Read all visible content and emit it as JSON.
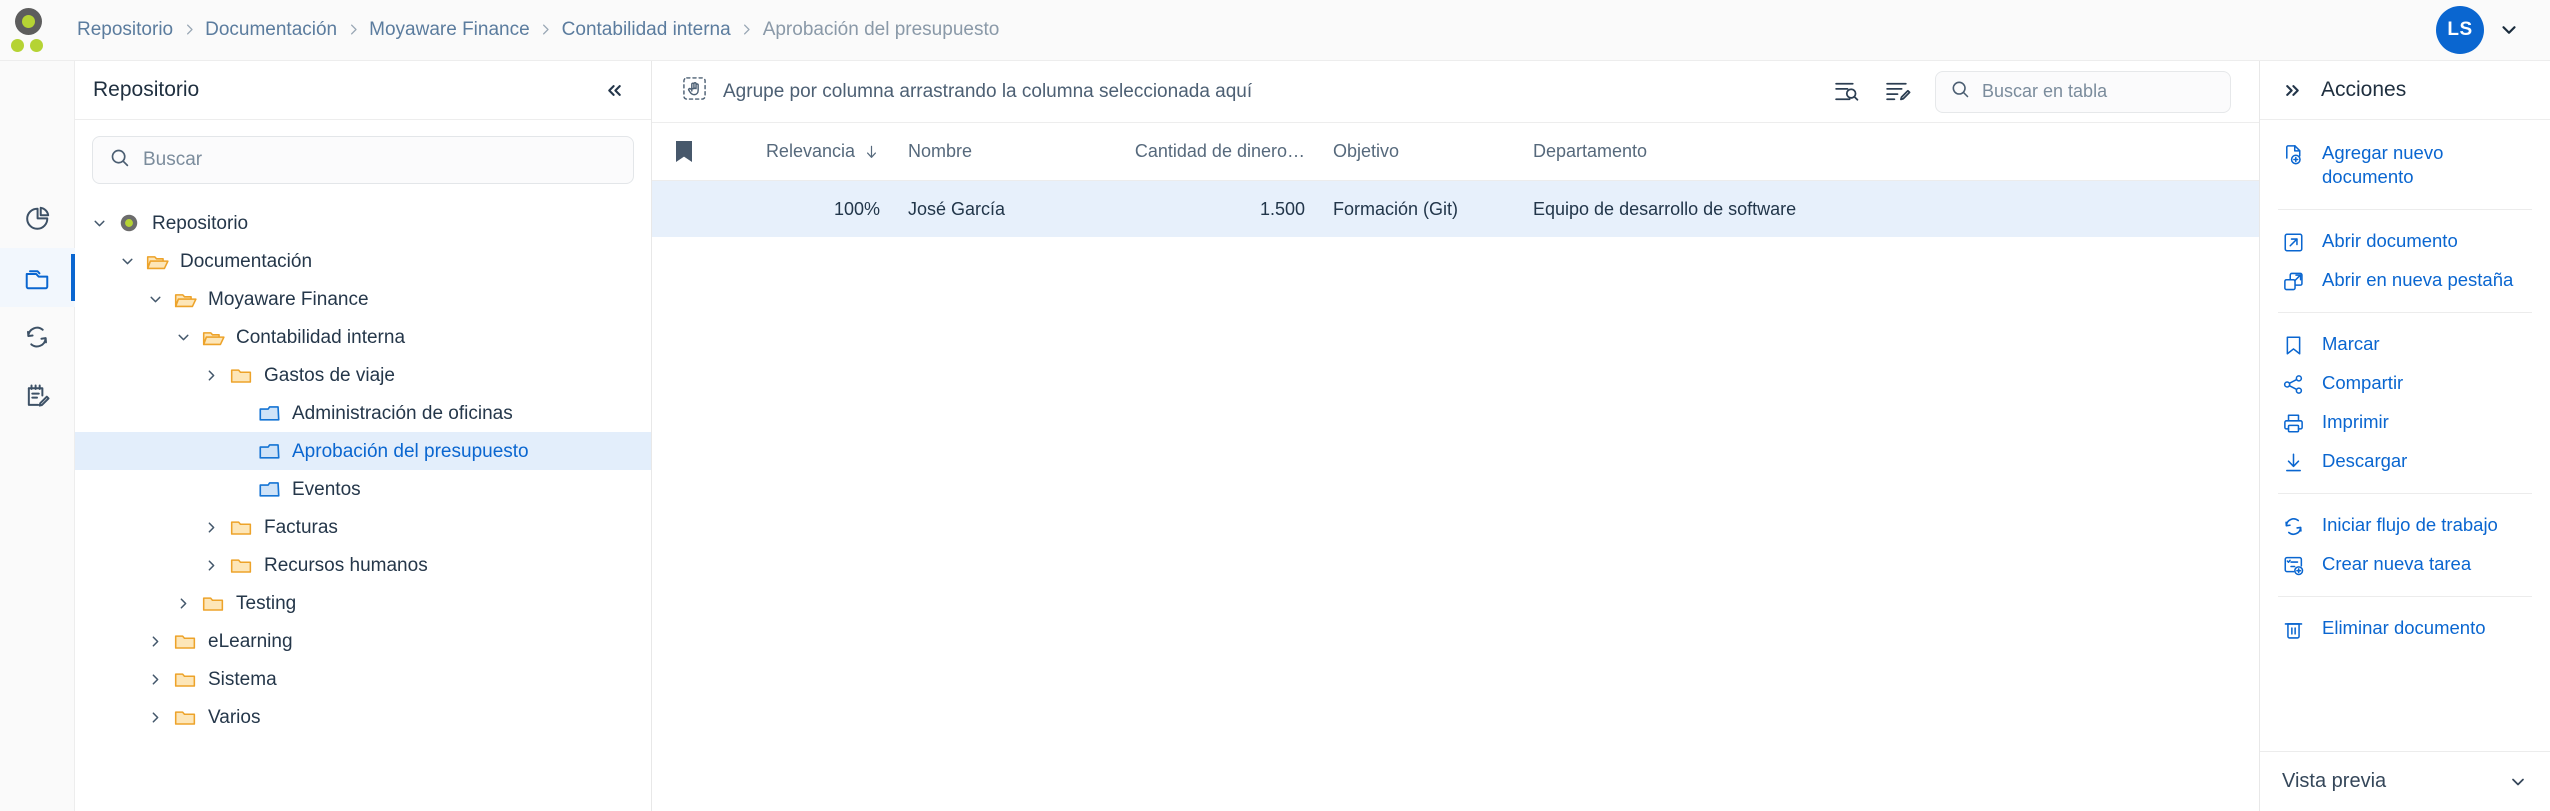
{
  "topbar": {
    "logo_name": "app-logo",
    "breadcrumb": [
      {
        "label": "Repositorio",
        "current": false
      },
      {
        "label": "Documentación",
        "current": false
      },
      {
        "label": "Moyaware Finance",
        "current": false
      },
      {
        "label": "Contabilidad interna",
        "current": false
      },
      {
        "label": "Aprobación del presupuesto",
        "current": true
      }
    ],
    "avatar_initials": "LS"
  },
  "rail": {
    "items": [
      {
        "icon": "pie-chart-icon",
        "active": false
      },
      {
        "icon": "folder-icon",
        "active": true
      },
      {
        "icon": "refresh-sync-icon",
        "active": false
      },
      {
        "icon": "notepad-edit-icon",
        "active": false
      }
    ]
  },
  "tree_panel": {
    "title": "Repositorio",
    "collapse_icon": "chevrons-left-icon",
    "search": {
      "value": "",
      "placeholder": "Buscar",
      "icon": "search-icon"
    },
    "nodes": [
      {
        "label": "Repositorio",
        "depth": 0,
        "twisty": "down",
        "icon": "repo-dot",
        "selected": false
      },
      {
        "label": "Documentación",
        "depth": 1,
        "twisty": "down",
        "icon": "folder-open",
        "selected": false
      },
      {
        "label": "Moyaware Finance",
        "depth": 2,
        "twisty": "down",
        "icon": "folder-open",
        "selected": false
      },
      {
        "label": "Contabilidad interna",
        "depth": 3,
        "twisty": "down",
        "icon": "folder-open",
        "selected": false
      },
      {
        "label": "Gastos de viaje",
        "depth": 4,
        "twisty": "right",
        "icon": "folder",
        "selected": false
      },
      {
        "label": "Administración de oficinas",
        "depth": 5,
        "twisty": "none",
        "icon": "folder-blue",
        "selected": false
      },
      {
        "label": "Aprobación del presupuesto",
        "depth": 5,
        "twisty": "none",
        "icon": "folder-blue",
        "selected": true
      },
      {
        "label": "Eventos",
        "depth": 5,
        "twisty": "none",
        "icon": "folder-blue",
        "selected": false
      },
      {
        "label": "Facturas",
        "depth": 4,
        "twisty": "right",
        "icon": "folder",
        "selected": false
      },
      {
        "label": "Recursos humanos",
        "depth": 4,
        "twisty": "right",
        "icon": "folder",
        "selected": false
      },
      {
        "label": "Testing",
        "depth": 3,
        "twisty": "right",
        "icon": "folder",
        "selected": false
      },
      {
        "label": "eLearning",
        "depth": 2,
        "twisty": "right",
        "icon": "folder",
        "selected": false
      },
      {
        "label": "Sistema",
        "depth": 2,
        "twisty": "right",
        "icon": "folder",
        "selected": false
      },
      {
        "label": "Varios",
        "depth": 2,
        "twisty": "right",
        "icon": "folder",
        "selected": false
      }
    ]
  },
  "grid": {
    "group_hint": "Agrupe por columna arrastrando la columna seleccionada aquí",
    "group_hint_icon": "drag-hand-icon",
    "toolbar_icons": [
      {
        "name": "column-filter-icon"
      },
      {
        "name": "edit-list-icon"
      }
    ],
    "search": {
      "value": "",
      "placeholder": "Buscar en tabla",
      "icon": "search-icon"
    },
    "columns": [
      {
        "key": "flag",
        "label": "",
        "icon": "bookmark-icon",
        "sort": null
      },
      {
        "key": "rel",
        "label": "Relevancia",
        "icon": null,
        "sort": "desc"
      },
      {
        "key": "name",
        "label": "Nombre",
        "icon": null,
        "sort": null
      },
      {
        "key": "amt",
        "label": "Cantidad de dinero…",
        "icon": null,
        "sort": null
      },
      {
        "key": "obj",
        "label": "Objetivo",
        "icon": null,
        "sort": null
      },
      {
        "key": "dep",
        "label": "Departamento",
        "icon": null,
        "sort": null
      }
    ],
    "rows": [
      {
        "flag": "",
        "rel": "100%",
        "name": "José García",
        "amt": "1.500",
        "obj": "Formación (Git)",
        "dep": "Equipo de desarrollo de software",
        "selected": true
      }
    ]
  },
  "actions": {
    "title": "Acciones",
    "expand_icon": "chevrons-right-icon",
    "items": [
      {
        "label": "Agregar nuevo documento",
        "icon": "document-add-icon",
        "sep_after": true
      },
      {
        "label": "Abrir documento",
        "icon": "open-external-icon",
        "sep_after": false
      },
      {
        "label": "Abrir en nueva pestaña",
        "icon": "new-tab-icon",
        "sep_after": true
      },
      {
        "label": "Marcar",
        "icon": "bookmark-icon",
        "sep_after": false
      },
      {
        "label": "Compartir",
        "icon": "share-icon",
        "sep_after": false
      },
      {
        "label": "Imprimir",
        "icon": "print-icon",
        "sep_after": false
      },
      {
        "label": "Descargar",
        "icon": "download-icon",
        "sep_after": true
      },
      {
        "label": "Iniciar flujo de trabajo",
        "icon": "workflow-icon",
        "sep_after": false
      },
      {
        "label": "Crear nueva tarea",
        "icon": "task-add-icon",
        "sep_after": true
      },
      {
        "label": "Eliminar documento",
        "icon": "trash-icon",
        "sep_after": false
      }
    ],
    "footer": {
      "label": "Vista previa",
      "icon": "chevron-down-icon"
    }
  },
  "colors": {
    "accent": "#0a66d0",
    "logo_green": "#b5d334",
    "row_selected": "#e7f0fb",
    "tree_selected": "#e3eefb",
    "folder_amber": "#f0a728",
    "folder_amber_fill": "#fde4b4"
  }
}
